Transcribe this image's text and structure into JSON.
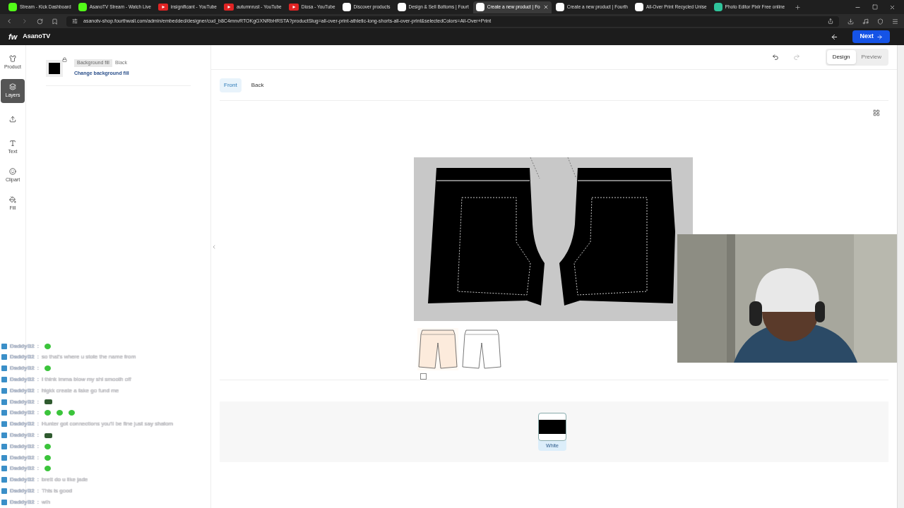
{
  "browser": {
    "tabs": [
      {
        "title": "Stream - Kick Dashboard",
        "kind": "kick",
        "selected": false
      },
      {
        "title": "AsanoTV Stream - Watch Live",
        "kind": "kick",
        "selected": false
      },
      {
        "title": "insignificant - YouTube",
        "kind": "youtube",
        "selected": false
      },
      {
        "title": "autumnrust - YouTube",
        "kind": "youtube",
        "selected": false
      },
      {
        "title": "Diosa - YouTube",
        "kind": "youtube",
        "selected": false
      },
      {
        "title": "Discover products",
        "kind": "fw",
        "selected": false
      },
      {
        "title": "Design & Sell Bottoms | Fourt",
        "kind": "fw",
        "selected": false
      },
      {
        "title": "Create a new product | Fo",
        "kind": "fw",
        "selected": true
      },
      {
        "title": "Create a new product | Fourth",
        "kind": "fw",
        "selected": false
      },
      {
        "title": "All-Over Print Recycled Unise",
        "kind": "fw",
        "selected": false
      },
      {
        "title": "Photo Editor Pixlr Free online",
        "kind": "pixlr",
        "selected": false
      }
    ],
    "url": "asanotv-shop.fourthwall.com/admin/embedded/designer/cud_b8C4mnvRTOKgGXNRbHRSTA?productSlug=all-over-print-athletic-long-shorts-all-over-print&selectedColors=All-Over+Print"
  },
  "app_header": {
    "logo": "fw",
    "shop_name": "AsanoTV",
    "next_button": "Next"
  },
  "rail": [
    {
      "label": "Product",
      "kind": "shirt",
      "selected": false
    },
    {
      "label": "Layers",
      "kind": "layers",
      "selected": true
    },
    {
      "kind": "upload",
      "selected": false
    },
    {
      "label": "Text",
      "kind": "text",
      "selected": false
    },
    {
      "label": "Clipart",
      "kind": "smile",
      "selected": false
    },
    {
      "label": "Fill",
      "kind": "fill",
      "selected": false
    }
  ],
  "layer": {
    "tag": "Background fill",
    "value": "Black",
    "link": "Change background fill"
  },
  "toolbar": {
    "modes": [
      {
        "label": "Design",
        "selected": true
      },
      {
        "label": "Preview",
        "selected": false
      }
    ]
  },
  "sides": [
    {
      "label": "Front",
      "selected": true
    },
    {
      "label": "Back",
      "selected": false
    }
  ],
  "thumbnails": [
    {
      "selected": true
    },
    {
      "selected": false
    }
  ],
  "view_checkbox": {
    "checked": false
  },
  "colors": [
    {
      "label": "White",
      "selected": true
    }
  ],
  "chat": [
    {
      "user": "DaddyB2",
      "separator": ":",
      "emotes": [
        {
          "kind": "blob"
        }
      ]
    },
    {
      "user": "DaddyB2",
      "separator": ":",
      "text": "so that's where u stole the name from"
    },
    {
      "user": "DaddyB2",
      "separator": ":",
      "emotes": [
        {
          "kind": "blob"
        }
      ]
    },
    {
      "user": "DaddyB2",
      "separator": ":",
      "text": "I think imma blow my shi smooth off"
    },
    {
      "user": "DaddyB2",
      "separator": ":",
      "text": "higkk create a fake go fund me"
    },
    {
      "user": "DaddyB2",
      "separator": ":",
      "emotes": [
        {
          "kind": "frog"
        }
      ]
    },
    {
      "user": "DaddyB2",
      "separator": ":",
      "emotes": [
        {
          "kind": "blob"
        },
        {
          "kind": "blob"
        },
        {
          "kind": "blob"
        }
      ]
    },
    {
      "user": "DaddyB2",
      "separator": ":",
      "text": "Hunter got connections you'll be fine just say shalom"
    },
    {
      "user": "DaddyB2",
      "separator": ":",
      "emotes": [
        {
          "kind": "frog"
        }
      ]
    },
    {
      "user": "DaddyB2",
      "separator": ":",
      "emotes": [
        {
          "kind": "blob"
        }
      ]
    },
    {
      "user": "DaddyB2",
      "separator": ":",
      "emotes": [
        {
          "kind": "blob"
        }
      ]
    },
    {
      "user": "DaddyB2",
      "separator": ":",
      "emotes": [
        {
          "kind": "blob"
        }
      ]
    },
    {
      "user": "DaddyB2",
      "separator": ":",
      "text": "brett do u like jade"
    },
    {
      "user": "DaddyB2",
      "separator": ":",
      "text": "This is good"
    },
    {
      "user": "DaddyB2",
      "separator": ":",
      "text": "wih"
    }
  ]
}
